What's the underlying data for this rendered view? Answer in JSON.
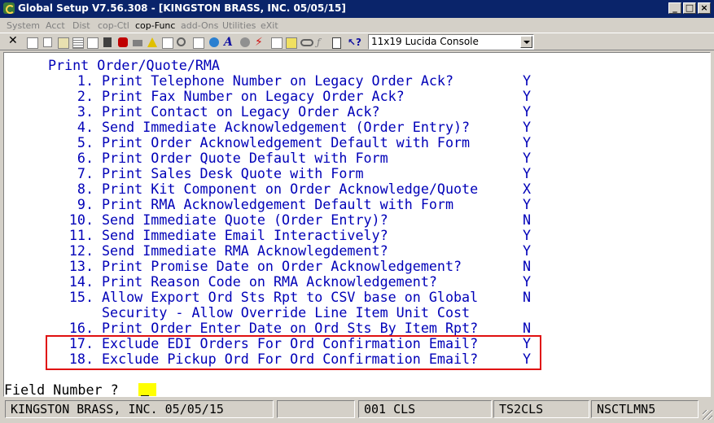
{
  "window": {
    "title": "Global Setup V7.56.308 - [KINGSTON BRASS, INC. 05/05/15]"
  },
  "menu": [
    "System",
    "Acct",
    "Dist",
    "cop-Ctl",
    "cop-Func",
    "add-Ons",
    "Utilities",
    "eXit"
  ],
  "font_select": {
    "value": "11x19 Lucida Console"
  },
  "screen": {
    "title": "Print Order/Quote/RMA",
    "options": [
      {
        "num": "1.",
        "text": "Print Telephone Number on Legacy Order Ack?",
        "value": "Y"
      },
      {
        "num": "2.",
        "text": "Print Fax Number on Legacy Order Ack?",
        "value": "Y"
      },
      {
        "num": "3.",
        "text": "Print Contact on Legacy Order Ack?",
        "value": "Y"
      },
      {
        "num": "4.",
        "text": "Send Immediate Acknowledgement (Order Entry)?",
        "value": "Y"
      },
      {
        "num": "5.",
        "text": "Print Order Acknowledgement Default with Form",
        "value": "Y"
      },
      {
        "num": "6.",
        "text": "Print Order Quote Default with Form",
        "value": "Y"
      },
      {
        "num": "7.",
        "text": "Print Sales Desk Quote with Form",
        "value": "Y"
      },
      {
        "num": "8.",
        "text": "Print Kit Component on Order Acknowledge/Quote",
        "value": "X"
      },
      {
        "num": "9.",
        "text": "Print RMA Acknowledgement Default with Form",
        "value": "Y"
      },
      {
        "num": "10.",
        "text": "Send Immediate Quote (Order Entry)?",
        "value": "N"
      },
      {
        "num": "11.",
        "text": "Send Immediate Email Interactively?",
        "value": "Y"
      },
      {
        "num": "12.",
        "text": "Send Immediate RMA Acknowlegdement?",
        "value": "Y"
      },
      {
        "num": "13.",
        "text": "Print Promise Date on Order Acknowledgement?",
        "value": "N"
      },
      {
        "num": "14.",
        "text": "Print Reason Code on RMA Acknowledgement?",
        "value": "Y"
      },
      {
        "num": "15.",
        "text": "Allow Export Ord Sts Rpt to CSV base on Global",
        "value": "N"
      },
      {
        "num": "",
        "text": "Security - Allow Override Line Item Unit Cost",
        "value": ""
      },
      {
        "num": "16.",
        "text": "Print Order Enter Date on Ord Sts By Item Rpt?",
        "value": "N"
      },
      {
        "num": "17.",
        "text": "Exclude EDI Orders For Ord Confirmation Email?",
        "value": "Y"
      },
      {
        "num": "18.",
        "text": "Exclude Pickup Ord For Ord Confirmation Email?",
        "value": "Y"
      }
    ],
    "prompt": "Field Number ?"
  },
  "status": {
    "company": "KINGSTON BRASS, INC. 05/05/15",
    "blank": "",
    "code": "001 CLS",
    "server": "TS2CLS",
    "station": "NSCTLMN5"
  },
  "colors": {
    "terminal_text": "#0000b8",
    "highlight_border": "#e01010",
    "cursor": "#ffff00",
    "titlebar": "#0a246a"
  }
}
